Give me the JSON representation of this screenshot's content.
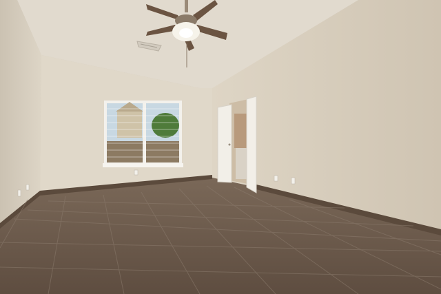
{
  "scene": {
    "description_label": "",
    "colors": {
      "ceiling": "#e3ddd2",
      "ceiling_shadow": "#d6cfc2",
      "wall_left": "#d9d1c2",
      "wall_back": "#e1d9ca",
      "wall_right": "#d8cebd",
      "baseboard": "#5b4a3c",
      "floor": "#6e5c4e",
      "floor_grout": "#8a7a6c",
      "window_frame": "#f3f1ec",
      "window_sky": "#c8d8e2",
      "window_tree": "#4f7b3a",
      "door": "#f2efe8",
      "fan_blade": "#6b5442",
      "fan_light": "#f6f3ea"
    },
    "icons": [
      "ceiling-fan-icon",
      "air-vent-icon",
      "electrical-outlet-icon"
    ]
  }
}
